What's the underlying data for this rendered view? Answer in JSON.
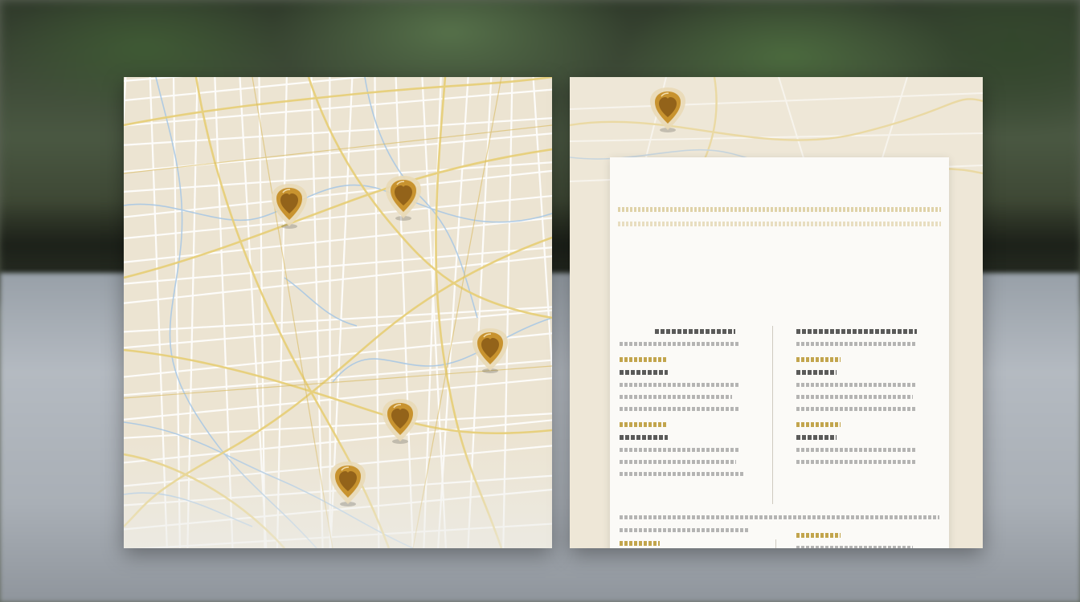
{
  "document": {
    "title": "",
    "map_pin_count": 5
  },
  "colors": {
    "paper": "#ece4d2",
    "road_major": "#e7cf7a",
    "road_minor": "#ffffff",
    "water": "#a9c8e4",
    "pin_gold": "#c8932f",
    "card": "#fbfaf7"
  },
  "icons": [
    "map-pin-icon"
  ]
}
